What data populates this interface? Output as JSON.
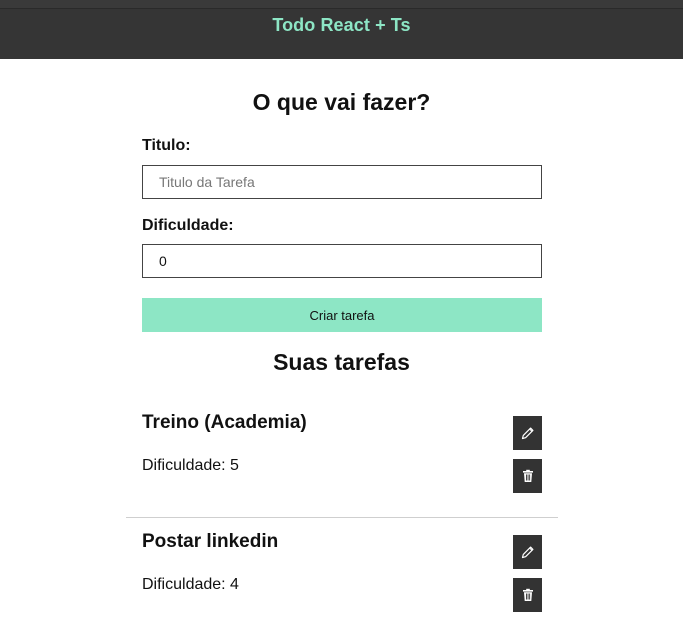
{
  "app": {
    "title": "Todo React + Ts"
  },
  "form": {
    "heading": "O que vai fazer?",
    "title_label": "Titulo:",
    "title_placeholder": "Titulo da Tarefa",
    "title_value": "",
    "difficulty_label": "Dificuldade:",
    "difficulty_value": "0",
    "submit_label": "Criar tarefa"
  },
  "list": {
    "heading": "Suas tarefas",
    "tasks": [
      {
        "title": "Treino (Academia)",
        "difficulty_text": "Dificuldade: 5"
      },
      {
        "title": "Postar linkedin",
        "difficulty_text": "Dificuldade: 4"
      }
    ]
  },
  "colors": {
    "header_bg": "#353535",
    "accent": "#8de6c5",
    "icon_button_bg": "#333333"
  },
  "icons": {
    "edit": "pencil-icon",
    "delete": "trash-icon"
  }
}
